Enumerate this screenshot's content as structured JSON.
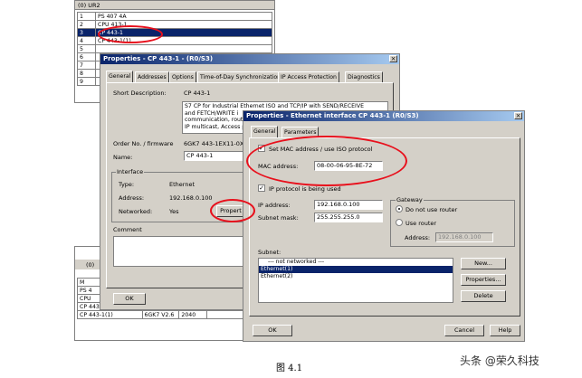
{
  "rack": {
    "title": "(0) UR2",
    "rows": [
      {
        "slot": "1",
        "name": "PS 407 4A"
      },
      {
        "slot": "2",
        "name": "CPU 413-1"
      },
      {
        "slot": "3",
        "name": "CP 443-1"
      },
      {
        "slot": "4",
        "name": "CP 443-1(1)"
      },
      {
        "slot": "5",
        "name": ""
      },
      {
        "slot": "6",
        "name": ""
      },
      {
        "slot": "7",
        "name": ""
      },
      {
        "slot": "8",
        "name": ""
      },
      {
        "slot": "9",
        "name": ""
      }
    ]
  },
  "rack2": {
    "title": "(0)",
    "rows": [
      {
        "c1": "M",
        "c2": "",
        "c3": "",
        "c4": ""
      },
      {
        "c1": "PS 4",
        "c2": "",
        "c3": "",
        "c4": ""
      },
      {
        "c1": "CPU",
        "c2": "",
        "c3": "",
        "c4": ""
      },
      {
        "c1": "CP 443-1",
        "c2": "",
        "c3": "",
        "c4": ""
      },
      {
        "c1": "CP 443-1(1)",
        "c2": "6GK7 V2.6",
        "c3": "2040",
        "c4": ""
      }
    ]
  },
  "props": {
    "title": "Properties - CP 443-1 - (R0/S3)",
    "tabs": [
      "General",
      "Addresses",
      "Options",
      "Time-of-Day Synchronization",
      "IP Access Protection",
      "Diagnostics"
    ],
    "short_desc_label": "Short Description:",
    "short_desc_value": "CP 443-1",
    "desc_lines": [
      "S7 CP for Industrial Ethernet ISO and TCP/IP  with SEND/RECEIVE",
      "and FETCH/WRITE i",
      "communication, routin",
      "IP multicast, Access p"
    ],
    "order_label": "Order No. / firmware",
    "order_value": "6GK7 443-1EX11-0XE",
    "name_label": "Name:",
    "name_value": "CP 443-1",
    "interface_label": "Interface",
    "type_label": "Type:",
    "type_value": "Ethernet",
    "address_label": "Address:",
    "address_value": "192.168.0.100",
    "networked_label": "Networked:",
    "networked_value": "Yes",
    "properties_btn": "Propert",
    "comment_label": "Comment",
    "ok": "OK"
  },
  "eth": {
    "title": "Properties - Ethernet interface  CP 443-1 (R0/S3)",
    "tabs": [
      "General",
      "Parameters"
    ],
    "set_mac_label": "Set MAC address / use ISO protocol",
    "mac_label": "MAC address:",
    "mac_value": "08-00-06-95-8E-72",
    "ip_used_label": "IP protocol is being used",
    "ip_label": "IP address:",
    "ip_value": "192.168.0.100",
    "mask_label": "Subnet mask:",
    "mask_value": "255.255.255.0",
    "gateway_label": "Gateway",
    "no_router_label": "Do not use router",
    "use_router_label": "Use router",
    "gw_address_label": "Address:",
    "gw_address_value": "192.168.0.100",
    "subnet_label": "Subnet:",
    "subnets": [
      "--- not networked ---",
      "Ethernet(1)",
      "Ethernet(2)"
    ],
    "new_btn": "New...",
    "properties_btn": "Properties...",
    "delete_btn": "Delete",
    "ok": "OK",
    "cancel": "Cancel",
    "help": "Help"
  },
  "caption": "图 4.1",
  "watermark": "头条 @荣久科技",
  "colors": {
    "highlight": "#0a246a",
    "annotation": "#e8101c"
  }
}
